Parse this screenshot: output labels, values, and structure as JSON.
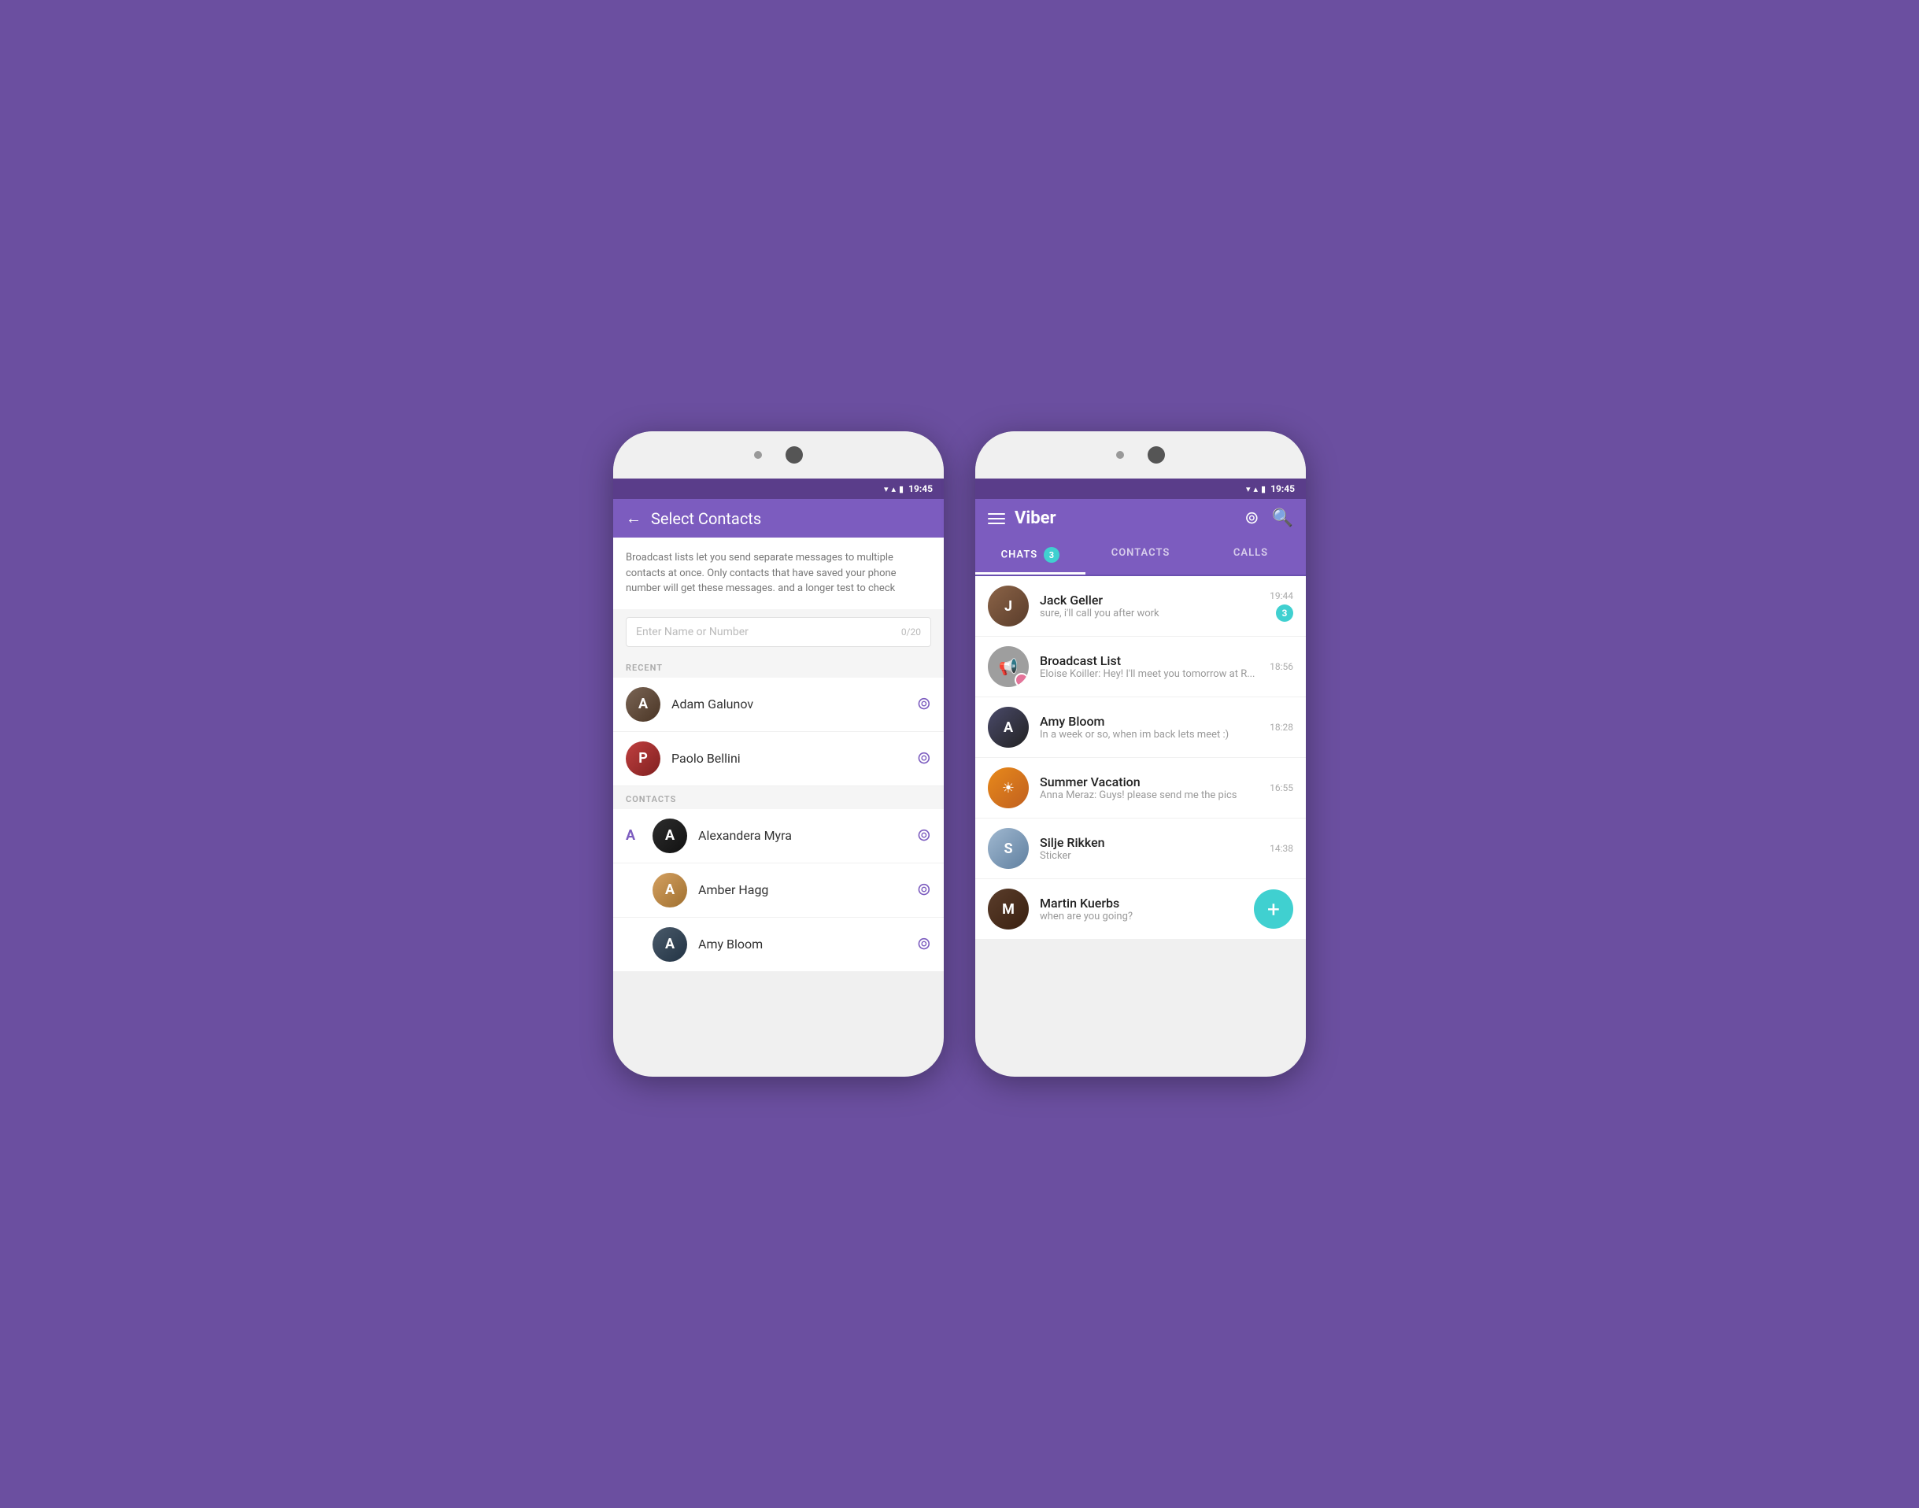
{
  "background_color": "#6b4fa0",
  "phone_left": {
    "status_bar": {
      "time": "19:45",
      "wifi": "▼",
      "signal": "▲",
      "battery": "▮"
    },
    "header": {
      "back_label": "←",
      "title": "Select Contacts"
    },
    "broadcast_info": "Broadcast lists let you send separate messages to multiple contacts at once. Only contacts that have saved your phone number will get these messages. and a longer test to check",
    "search": {
      "placeholder": "Enter Name or Number",
      "counter": "0/20"
    },
    "recent_label": "RECENT",
    "recent_contacts": [
      {
        "name": "Adam Galunov",
        "avatar_class": "av-adam"
      },
      {
        "name": "Paolo Bellini",
        "avatar_class": "av-paolo"
      }
    ],
    "contacts_label": "CONTACTS",
    "alpha_label": "A",
    "contacts": [
      {
        "name": "Alexandera Myra",
        "avatar_class": "av-alex"
      },
      {
        "name": "Amber Hagg",
        "avatar_class": "av-amber"
      },
      {
        "name": "Amy Bloom",
        "avatar_class": "av-amy2"
      }
    ]
  },
  "phone_right": {
    "status_bar": {
      "time": "19:45"
    },
    "header": {
      "app_title": "Viber"
    },
    "tabs": [
      {
        "label": "CHATS",
        "badge": "3",
        "active": true
      },
      {
        "label": "CONTACTS",
        "badge": null,
        "active": false
      },
      {
        "label": "CALLS",
        "badge": null,
        "active": false
      }
    ],
    "chats": [
      {
        "name": "Jack Geller",
        "preview": "sure, i'll call you after work",
        "time": "19:44",
        "unread": "3",
        "avatar_class": "av-jack",
        "has_mini": false
      },
      {
        "name": "Broadcast List",
        "preview": "Eloise Koiller: Hey! I'll meet you tomorrow at R...",
        "time": "18:56",
        "unread": null,
        "avatar_class": "av-broadcast",
        "has_mini": true
      },
      {
        "name": "Amy Bloom",
        "preview": "In a week or so, when im back lets meet :)",
        "time": "18:28",
        "unread": null,
        "avatar_class": "av-amy",
        "has_mini": false
      },
      {
        "name": "Summer Vacation",
        "preview": "Anna Meraz: Guys! please send me the pics",
        "time": "16:55",
        "unread": null,
        "avatar_class": "av-summer",
        "has_mini": true
      },
      {
        "name": "Silje Rikken",
        "preview": "Sticker",
        "time": "14:38",
        "unread": null,
        "avatar_class": "av-silje",
        "has_mini": false
      },
      {
        "name": "Martin Kuerbs",
        "preview": "when are you going?",
        "time": null,
        "unread": null,
        "avatar_class": "av-martin",
        "has_mini": false,
        "has_fab": true
      }
    ]
  }
}
